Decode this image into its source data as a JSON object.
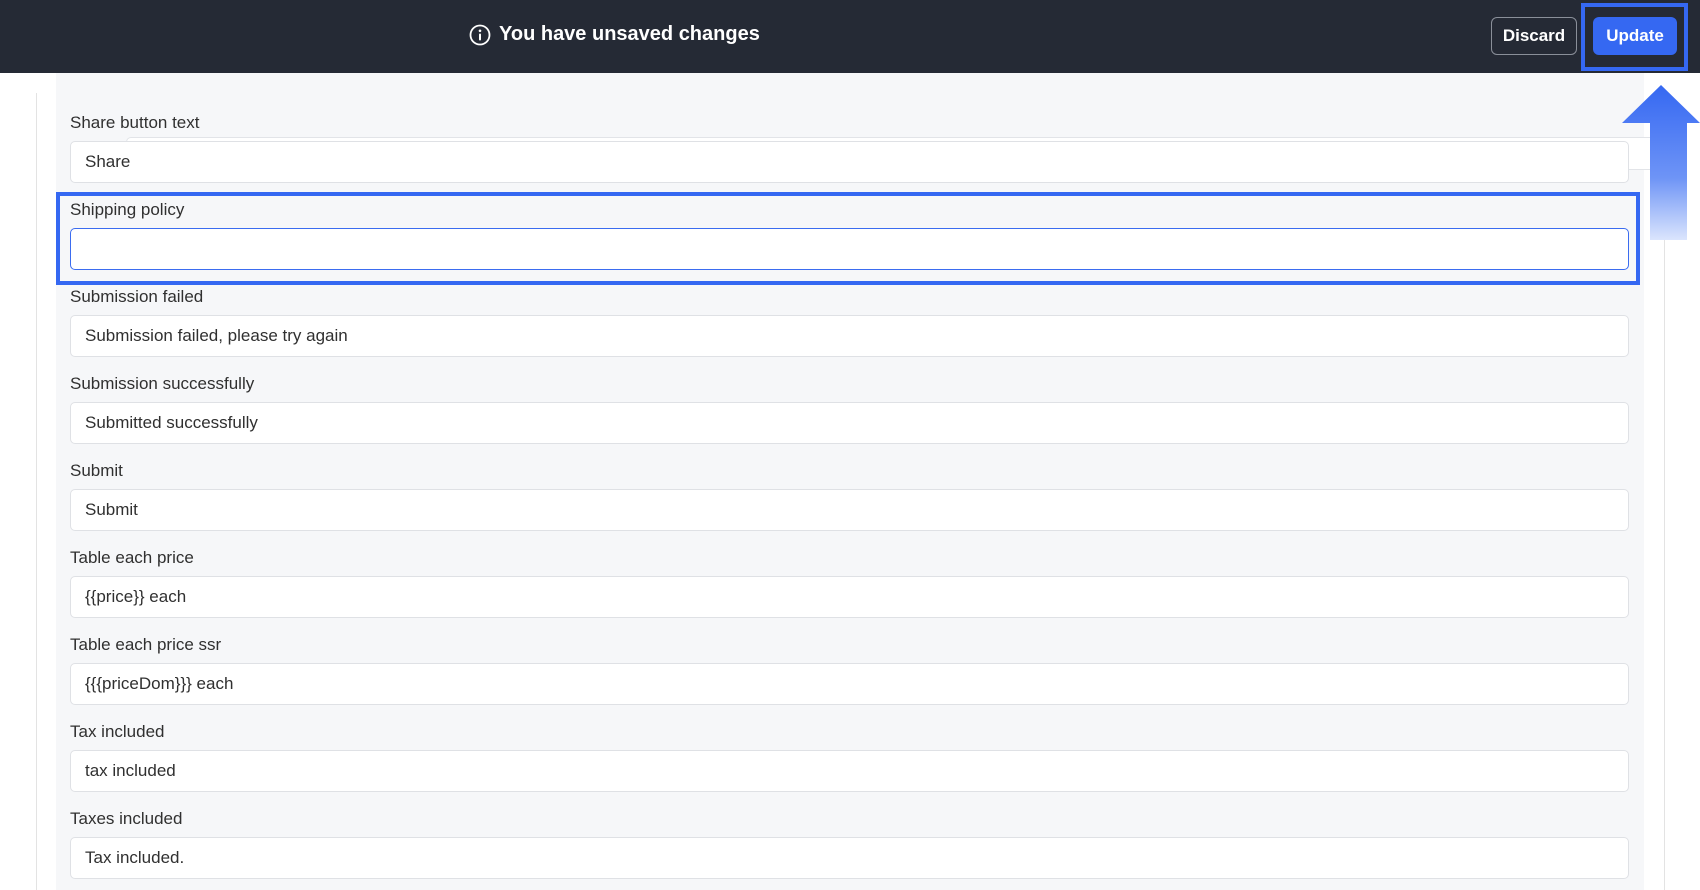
{
  "header": {
    "unsaved_message": "You have unsaved changes",
    "discard_label": "Discard",
    "update_label": "Update",
    "info_icon": "info-circle-icon",
    "background_color": "#252a35",
    "accent_color": "#3568f2"
  },
  "fields": [
    {
      "label": "Share button text",
      "value": ""
    },
    {
      "label": "Shipping policy",
      "value": ""
    },
    {
      "label": "Submission failed",
      "value": "Submission failed, please try again"
    },
    {
      "label": "Submission successfully",
      "value": "Submitted successfully"
    },
    {
      "label": "Submit",
      "value": "Submit"
    },
    {
      "label": "Table each price",
      "value": "{{price}} each"
    },
    {
      "label": "Table each price ssr",
      "value": "{{{priceDom}}} each"
    },
    {
      "label": "Tax included",
      "value": "tax included"
    },
    {
      "label": "Taxes included",
      "value": "Tax included."
    }
  ],
  "share_field_value": "Share",
  "annotation": {
    "highlighted_field": "Shipping policy",
    "arrow_icon": "up-arrow-icon",
    "highlight_color": "#3568f2"
  }
}
